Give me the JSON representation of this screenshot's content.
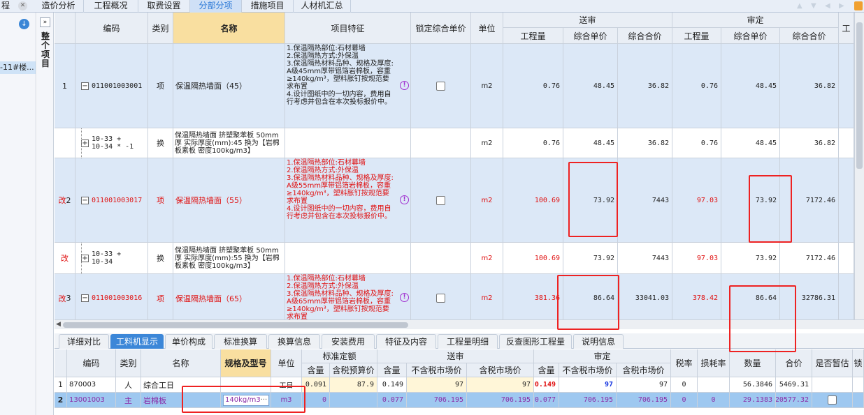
{
  "top_tabs": {
    "program_label": "程",
    "tabs": [
      "造价分析",
      "工程概况",
      "取费设置",
      "分部分项",
      "措施项目",
      "人材机汇总"
    ],
    "active": "分部分项"
  },
  "left": {
    "item_label": "-11#楼...",
    "expand_glyph": "»",
    "vertical_title": "整个项目"
  },
  "grid": {
    "headers": {
      "code": "编码",
      "type": "类别",
      "name": "名称",
      "feature": "项目特征",
      "lock": "锁定综合单价",
      "unit": "单位",
      "group_send": "送审",
      "group_review": "审定",
      "qty": "工程量",
      "unit_price": "综合单价",
      "total_price": "综合合价",
      "cut": "工"
    },
    "rows": [
      {
        "index": "1",
        "flag": "",
        "code": "011001003001",
        "tree": "−",
        "type": "项",
        "name": "保温隔热墙面（45）",
        "feature": "1.保温隔热部位:石材幕墙\n2.保温隔热方式:外保温\n3.保温隔热材料品种、规格及厚度: A级45mm厚带铝箔岩棉板，容重≥140kg/m³，塑料胀钉按规范要求布置\n4.设计图纸中的一切内容，费用自行考虑并包含在本次投标报价中。",
        "unit": "m2",
        "s_qty": "0.76",
        "s_price": "48.45",
        "s_total": "36.82",
        "r_qty": "0.76",
        "r_price": "48.45",
        "r_total": "36.82"
      },
      {
        "index": "",
        "flag": "",
        "code": "10-33 +\n10-34 * -1",
        "tree": "+",
        "type": "换",
        "name": "保温隔热墙面 挤塑聚苯板 50mm厚  实际厚度(mm):45  换为【岩棉板素板 密度100kg/m3】",
        "feature": "",
        "unit": "m2",
        "s_qty": "0.76",
        "s_price": "48.45",
        "s_total": "36.82",
        "r_qty": "0.76",
        "r_price": "48.45",
        "r_total": "36.82"
      },
      {
        "index": "2",
        "flag": "改",
        "code": "011001003017",
        "tree": "−",
        "type": "项",
        "name": "保温隔热墙面（55）",
        "feature": "1.保温隔热部位:石材幕墙\n2.保温隔热方式:外保温\n3.保温隔热材料品种、规格及厚度: A级55mm厚带铝箔岩棉板，容重≥140kg/m³，塑料胀钉按规范要求布置\n4.设计图纸中的一切内容，费用自行考虑并包含在本次投标报价中。",
        "unit": "m2",
        "s_qty": "100.69",
        "s_price": "73.92",
        "s_total": "7443",
        "r_qty": "97.03",
        "r_price": "73.92",
        "r_total": "7172.46"
      },
      {
        "index": "",
        "flag": "改",
        "code": "10-33 +\n10-34",
        "tree": "+",
        "type": "换",
        "name": "保温隔热墙面 挤塑聚苯板 50mm厚  实际厚度(mm):55  换为【岩棉板素板 密度100kg/m3】",
        "feature": "",
        "unit": "m2",
        "s_qty": "100.69",
        "s_price": "73.92",
        "s_total": "7443",
        "r_qty": "97.03",
        "r_price": "73.92",
        "r_total": "7172.46"
      },
      {
        "index": "3",
        "flag": "改",
        "code": "011001003016",
        "tree": "−",
        "type": "项",
        "name": "保温隔热墙面（65）",
        "feature": "1.保温隔热部位:石材幕墙\n2.保温隔热方式:外保温\n3.保温隔热材料品种、规格及厚度: A级65mm厚带铝箔岩棉板，容重≥140kg/m³，塑料胀钉按规范要求布置",
        "unit": "m2",
        "s_qty": "381.36",
        "s_price": "86.64",
        "s_total": "33041.03",
        "r_qty": "378.42",
        "r_price": "86.64",
        "r_total": "32786.31"
      }
    ]
  },
  "bottom_tabs": {
    "tabs": [
      "详细对比",
      "工料机显示",
      "单价构成",
      "标准换算",
      "换算信息",
      "安装费用",
      "特征及内容",
      "工程量明细",
      "反查图形工程量",
      "说明信息"
    ],
    "active": "工料机显示"
  },
  "bottom_grid": {
    "headers": {
      "code": "编码",
      "type": "类别",
      "name": "名称",
      "spec": "规格及型号",
      "unit": "单位",
      "g_std": "标准定额",
      "g_send": "送审",
      "g_review": "审定",
      "qty_content": "含量",
      "tax_budget": "含税预算价",
      "notax_market": "不含税市场价",
      "tax_market": "含税市场价",
      "tax_rate": "税率",
      "loss_rate": "损耗率",
      "amount": "数量",
      "total": "合价",
      "is_est": "是否暂估",
      "cut": "锁"
    },
    "rows": [
      {
        "index": "1",
        "code": "870003",
        "type": "人",
        "name": "综合工日",
        "spec": "",
        "unit": "工日",
        "std_qty": "0.091",
        "std_price": "87.9",
        "s_qty": "0.149",
        "s_notax": "97",
        "s_tax": "97",
        "r_qty": "0.149",
        "r_notax": "97",
        "r_tax": "97",
        "tax_rate": "0",
        "loss": "",
        "amount": "56.3846",
        "total": "5469.31"
      },
      {
        "index": "2",
        "code": "13001003",
        "type": "主",
        "name": "岩棉板",
        "spec": "140kg/m3",
        "spec_more": "···",
        "unit": "m3",
        "std_qty": "0",
        "std_price": "",
        "s_qty": "0.077",
        "s_notax": "706.195",
        "s_tax": "706.195",
        "r_qty": "0.077",
        "r_notax": "706.195",
        "r_tax": "706.195",
        "tax_rate": "0",
        "loss": "0",
        "amount": "29.1383",
        "total": "20577.32"
      }
    ]
  },
  "colors": {
    "accent": "#3c87d8",
    "highlight": "#e22222",
    "name_header": "#f9dfa0",
    "row_blue": "#dce8f7"
  }
}
